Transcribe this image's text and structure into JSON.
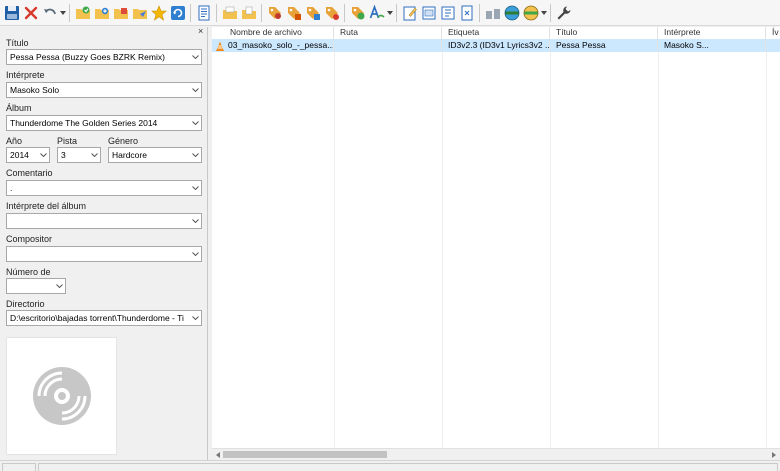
{
  "toolbar": {
    "buttons": [
      {
        "icon": "save-icon"
      },
      {
        "icon": "delete-icon"
      },
      {
        "icon": "undo-icon"
      },
      {
        "icon": "open-folder-icon"
      },
      {
        "icon": "add-folder-icon"
      },
      {
        "icon": "playlist-icon"
      },
      {
        "icon": "send-icon"
      },
      {
        "icon": "favorite-star-icon"
      },
      {
        "icon": "refresh-icon"
      },
      {
        "icon": "tag-panel-icon"
      },
      {
        "icon": "tag-sources-icon"
      }
    ],
    "colors": {
      "save": "#1f5fa8",
      "delete": "#d83a2c",
      "folder": "#f2c14e",
      "star": "#f5b800",
      "refresh": "#2f7fd0"
    }
  },
  "tag_panel": {
    "close_glyph": "×",
    "title": {
      "label": "Título",
      "value": "Pessa Pessa (Buzzy Goes BZRK Remix)"
    },
    "artist": {
      "label": "Intérprete",
      "value": "Masoko Solo"
    },
    "album": {
      "label": "Álbum",
      "value": "Thunderdome The Golden Series 2014"
    },
    "year": {
      "label": "Año",
      "value": "2014"
    },
    "track": {
      "label": "Pista",
      "value": "3"
    },
    "genre": {
      "label": "Género",
      "value": "Hardcore"
    },
    "comment": {
      "label": "Comentario",
      "value": "."
    },
    "album_artist": {
      "label": "Intérprete del álbum",
      "value": ""
    },
    "composer": {
      "label": "Compositor",
      "value": ""
    },
    "disc_number": {
      "label": "Número de",
      "value": ""
    },
    "directory": {
      "label": "Directorio",
      "value": "D:\\escritorio\\bajadas torrent\\Thunderdome - Ti"
    },
    "cover": {
      "icon": "cd-placeholder-icon"
    }
  },
  "file_list": {
    "columns": [
      "Nombre de archivo",
      "Ruta",
      "Etiqueta",
      "Título",
      "Intérprete",
      "Ív"
    ],
    "rows": [
      {
        "filename": "03_masoko_solo_-_pessa...",
        "path": "",
        "tag": "ID3v2.3 (ID3v1 Lyrics3v2 ...",
        "title": "Pessa Pessa",
        "artist": "Masoko S...",
        "icon": "vlc-file-icon"
      }
    ],
    "selected_row_color": "#cce8ff"
  }
}
